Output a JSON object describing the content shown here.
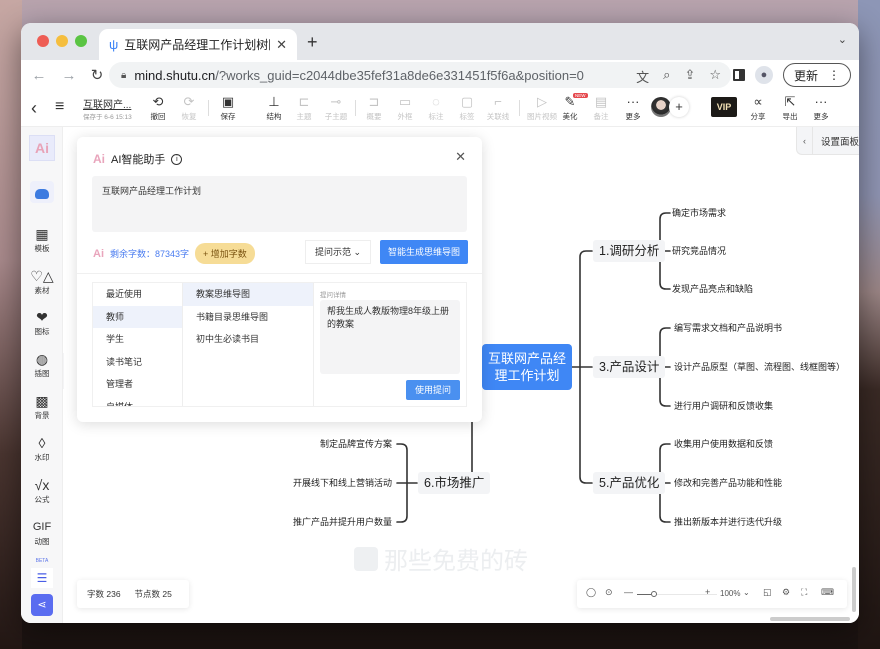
{
  "browser": {
    "tab_title": "互联网产品经理工作计划树图思维",
    "new_tab": "+",
    "url_host": "mind.shutu.cn",
    "url_path": "/?works_guid=c2044dbe35fef31a8de6e331451f5f6a&position=0",
    "update_label": "更新",
    "menu_label": "⋮"
  },
  "toolbar": {
    "doc_name": "互联网产...",
    "saved_at": "保存于 6-6 15:13",
    "buttons": [
      {
        "icon": "undo-icon",
        "label": "撤回",
        "enabled": true
      },
      {
        "icon": "redo-icon",
        "label": "恢复",
        "enabled": false
      },
      {
        "icon": "save-icon",
        "label": "保存",
        "enabled": true
      },
      {
        "icon": "structure-icon",
        "label": "结构",
        "enabled": true
      },
      {
        "icon": "topic-icon",
        "label": "主题",
        "enabled": false
      },
      {
        "icon": "subtopic-icon",
        "label": "子主题",
        "enabled": false
      },
      {
        "icon": "summary-icon",
        "label": "概要",
        "enabled": false
      },
      {
        "icon": "frame-icon",
        "label": "外框",
        "enabled": false
      },
      {
        "icon": "note-icon",
        "label": "标注",
        "enabled": false
      },
      {
        "icon": "tag-icon",
        "label": "标签",
        "enabled": false
      },
      {
        "icon": "relation-icon",
        "label": "关联线",
        "enabled": false
      },
      {
        "icon": "media-icon",
        "label": "图片视频",
        "enabled": false
      },
      {
        "icon": "beautify-icon",
        "label": "美化",
        "enabled": true,
        "badge": "NEW"
      },
      {
        "icon": "remark-icon",
        "label": "备注",
        "enabled": false
      },
      {
        "icon": "more-icon",
        "label": "更多",
        "enabled": true
      }
    ],
    "vip_label": "VIP",
    "right_buttons": [
      {
        "icon": "share-icon",
        "label": "分享"
      },
      {
        "icon": "export-icon",
        "label": "导出"
      },
      {
        "icon": "more-icon",
        "label": "更多"
      }
    ]
  },
  "sidebar": {
    "ai_label": "Ai",
    "items": [
      {
        "icon": "template-icon",
        "label": "模板"
      },
      {
        "icon": "material-icon",
        "label": "素材"
      },
      {
        "icon": "icon-library-icon",
        "label": "图标"
      },
      {
        "icon": "illustration-icon",
        "label": "插图"
      },
      {
        "icon": "background-icon",
        "label": "背景"
      },
      {
        "icon": "watermark-icon",
        "label": "水印"
      },
      {
        "icon": "formula-icon",
        "label": "公式"
      },
      {
        "icon": "gif-icon",
        "label": "动图",
        "glyph": "GIF"
      }
    ],
    "beta_label": "BETA"
  },
  "settings_panel": {
    "label": "设置面板"
  },
  "ai_dialog": {
    "title": "AI智能助手",
    "prompt_text": "互联网产品经理工作计划",
    "remaining_label": "剩余字数：87343字",
    "add_chars_label": "+ 增加字数",
    "example_label": "提问示范",
    "generate_label": "智能生成思维导图",
    "categories": [
      "最近使用",
      "教师",
      "学生",
      "读书笔记",
      "管理者",
      "自媒体"
    ],
    "selected_category": 1,
    "templates": [
      "教案思维导图",
      "书籍目录思维导图",
      "初中生必读书目"
    ],
    "selected_template": 0,
    "detail_label": "提问详情",
    "detail_text": "帮我生成人教版物理8年级上册的教案",
    "use_label": "使用提问"
  },
  "mindmap": {
    "root": "互联网产品经理工作计划",
    "branches": [
      {
        "title": "1.调研分析",
        "children": [
          "确定市场需求",
          "研究竞品情况",
          "发现产品亮点和缺陷"
        ]
      },
      {
        "title": "3.产品设计",
        "children": [
          "编写需求文档和产品说明书",
          "设计产品原型（草图、流程图、线框图等）",
          "进行用户调研和反馈收集"
        ]
      },
      {
        "title": "5.产品优化",
        "children": [
          "收集用户使用数据和反馈",
          "修改和完善产品功能和性能",
          "推出新版本并进行迭代升级"
        ]
      },
      {
        "title": "6.市场推广",
        "children": [
          "制定品牌宣传方案",
          "开展线下和线上营销活动",
          "推广产品并提升用户数量"
        ]
      }
    ]
  },
  "watermark": "那些免费的砖",
  "stats": {
    "chars": "字数 236",
    "nodes": "节点数 25"
  },
  "zoom": {
    "level": "100%",
    "minus": "—",
    "plus": "+"
  }
}
